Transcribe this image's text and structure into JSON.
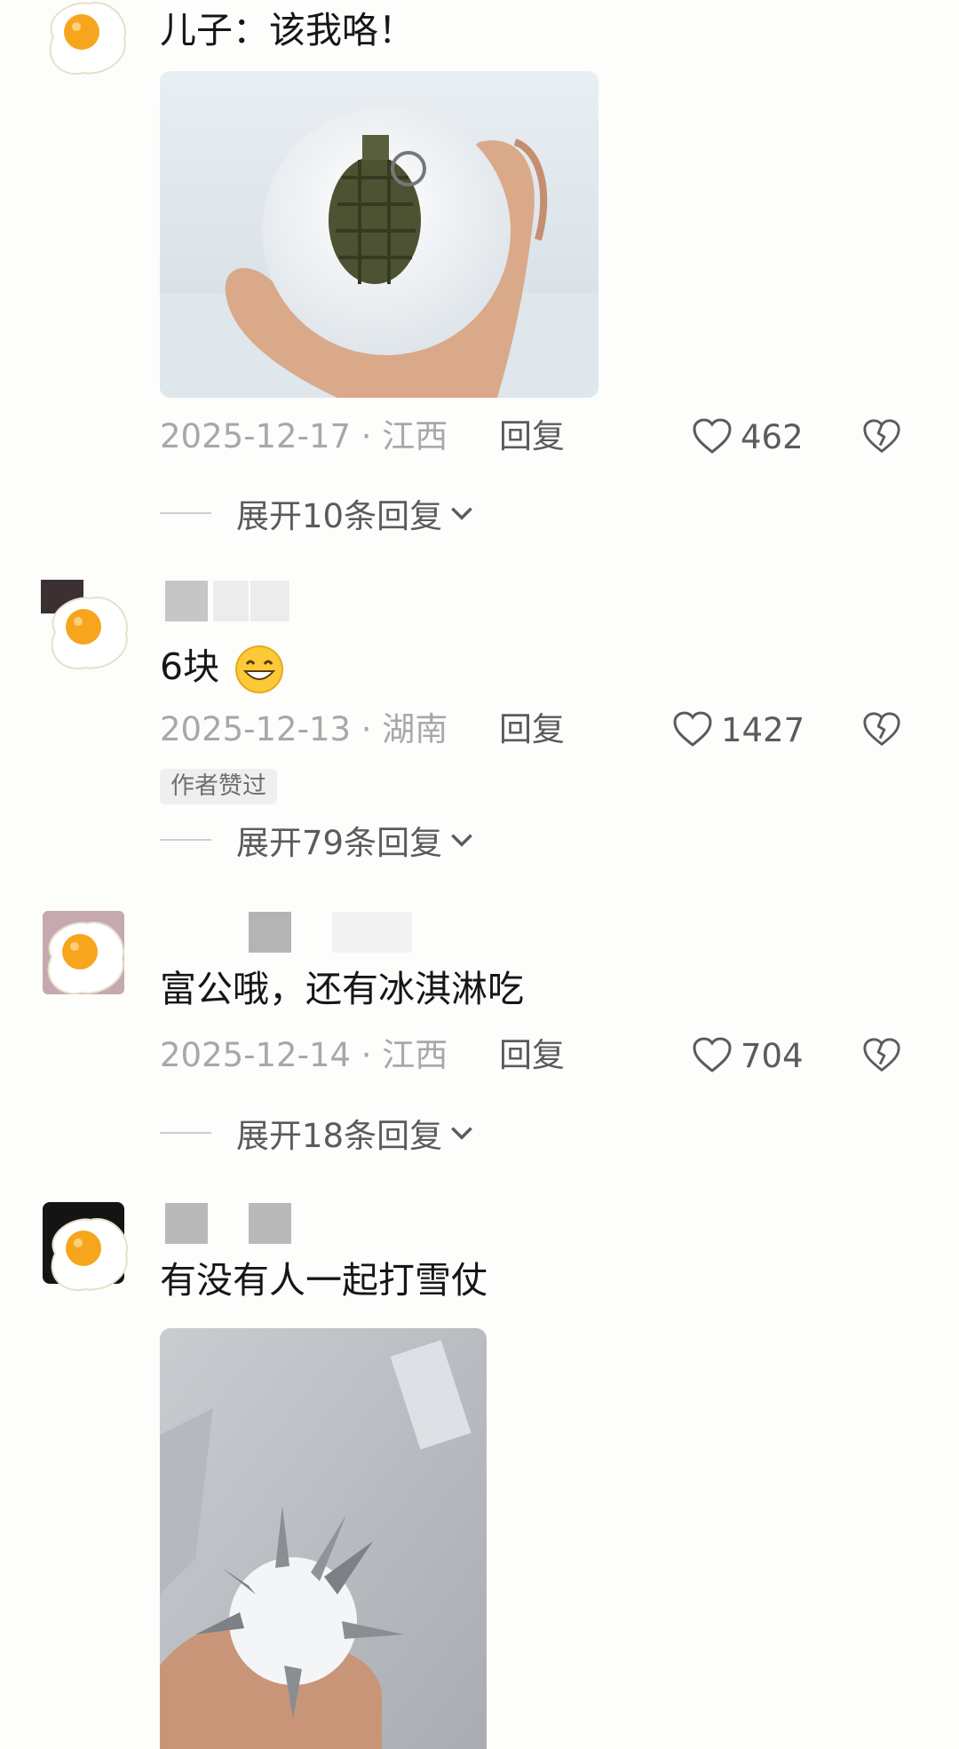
{
  "comments": [
    {
      "text": "儿子：该我咯！",
      "date_location": "2025-12-17 · 江西",
      "reply_label": "回复",
      "likes": "462",
      "expand_label": "展开10条回复"
    },
    {
      "text": "6块",
      "date_location": "2025-12-13 · 湖南",
      "reply_label": "回复",
      "likes": "1427",
      "author_badge": "作者赞过",
      "expand_label": "展开79条回复"
    },
    {
      "text": "富公哦，还有冰淇淋吃",
      "date_location": "2025-12-14 · 江西",
      "reply_label": "回复",
      "likes": "704",
      "expand_label": "展开18条回复"
    },
    {
      "text": "有没有人一起打雪仗"
    }
  ],
  "icons": {
    "avatar": "fried-egg-avatar",
    "like": "heart-outline-icon",
    "dislike": "broken-heart-icon",
    "expand": "chevron-down-icon",
    "emoji": "grinning-face-emoji"
  },
  "colors": {
    "background": "#fdfdfb",
    "text": "#161616",
    "meta": "#a8a8a8",
    "action": "#5b5b5b",
    "egg_yolk": "#f7a51c"
  }
}
